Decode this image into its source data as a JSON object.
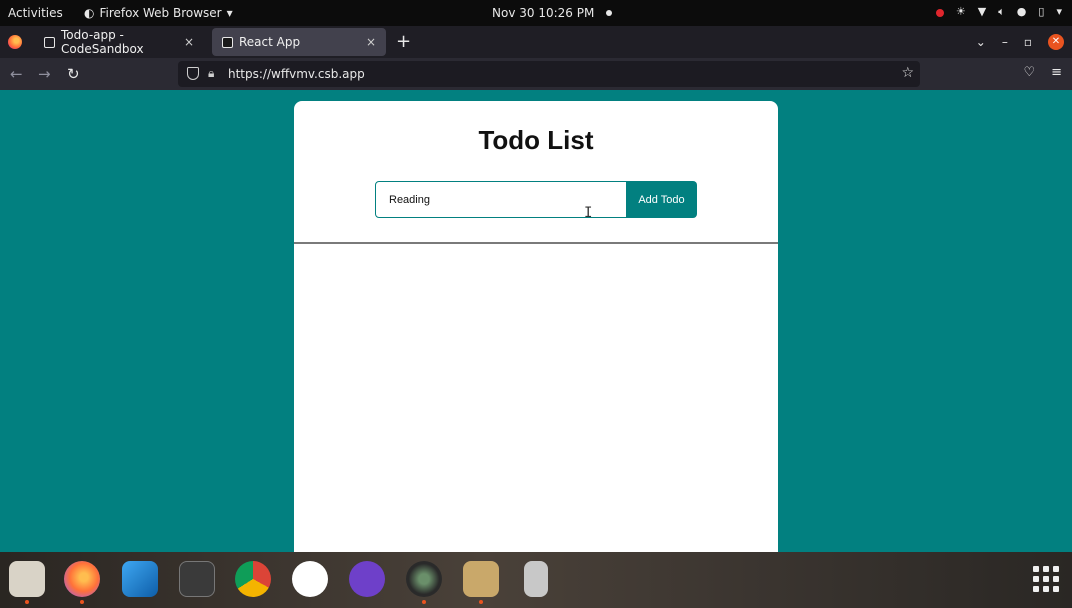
{
  "topbar": {
    "activities": "Activities",
    "app_menu": "Firefox Web Browser",
    "clock": "Nov 30  10:26 PM"
  },
  "tabs": [
    {
      "title": "Todo-app - CodeSandbox",
      "close": "×"
    },
    {
      "title": "React App",
      "close": "×"
    }
  ],
  "newtab": "+",
  "navbar": {
    "url": "https://wffvmv.csb.app"
  },
  "page": {
    "heading": "Todo List",
    "input_value": "Reading",
    "add_button": "Add Todo",
    "todos": []
  },
  "colors": {
    "page_background": "#028080",
    "accent": "#028080",
    "card": "#ffffff"
  },
  "dock": {
    "items": [
      "files-icon",
      "firefox-icon",
      "vscode-icon",
      "terminal-icon",
      "chrome-icon",
      "slack-icon",
      "github-desktop-icon",
      "camera-app-icon",
      "archive-manager-icon",
      "text-editor-icon"
    ]
  }
}
